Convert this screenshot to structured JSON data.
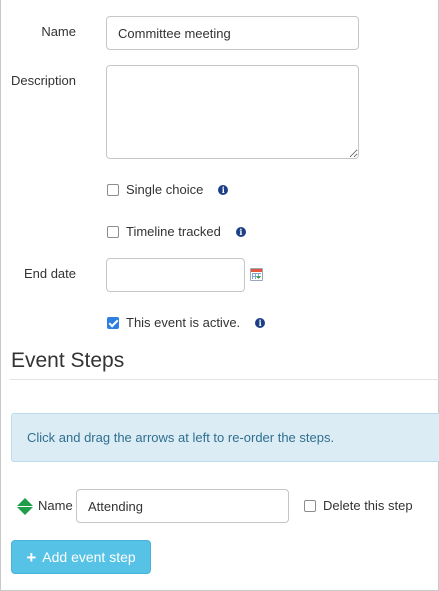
{
  "form": {
    "name_label": "Name",
    "name_value": "Committee meeting",
    "description_label": "Description",
    "description_value": "",
    "single_choice_label": "Single choice",
    "single_choice_checked": false,
    "timeline_tracked_label": "Timeline tracked",
    "timeline_tracked_checked": false,
    "end_date_label": "End date",
    "end_date_value": "",
    "active_label": "This event is active.",
    "active_checked": true
  },
  "steps": {
    "title": "Event Steps",
    "help_text": "Click and drag the arrows at left to re-order the steps.",
    "items": [
      {
        "name_label": "Name",
        "name_value": "Attending",
        "delete_label": "Delete this step",
        "delete_checked": false
      }
    ],
    "add_button_label": "Add event step"
  },
  "icons": {
    "info": "info-icon",
    "calendar": "calendar-icon",
    "drag": "drag-handle-icon",
    "add": "plus-icon"
  },
  "colors": {
    "accent": "#56c2e6",
    "checkbox_checked": "#2f7fe0",
    "info_icon": "#1d3f86",
    "drag_handle": "#1e9e4a",
    "alert_bg": "#dcecf5",
    "alert_text": "#2f6f8f"
  }
}
